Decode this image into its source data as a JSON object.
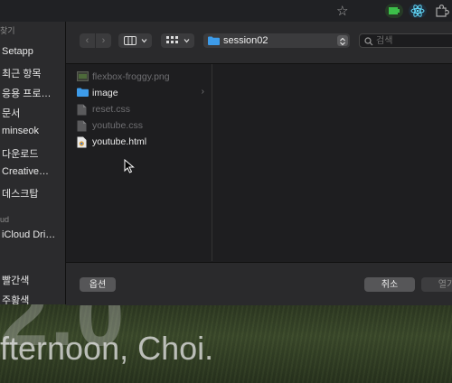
{
  "desktop": {
    "big_number": "2.0",
    "greeting": "fternoon, Choi."
  },
  "sidebar": {
    "section_favorites": "찾기",
    "section_icloud": "ud",
    "items": [
      {
        "label": "Setapp"
      },
      {
        "label": "최근 항목"
      },
      {
        "label": "응용 프로…"
      },
      {
        "label": "문서"
      },
      {
        "label": "minseok"
      },
      {
        "label": "다운로드"
      },
      {
        "label": "Creative…"
      },
      {
        "label": "데스크탑"
      },
      {
        "label": "iCloud Dri…"
      },
      {
        "label": "빨간색"
      },
      {
        "label": "주황색"
      }
    ]
  },
  "toolbar": {
    "path": "session02",
    "search_placeholder": "검색"
  },
  "files": [
    {
      "name": "flexbox-froggy.png",
      "type": "image",
      "enabled": false
    },
    {
      "name": "image",
      "type": "folder",
      "enabled": true
    },
    {
      "name": "reset.css",
      "type": "file",
      "enabled": false
    },
    {
      "name": "youtube.css",
      "type": "file",
      "enabled": false
    },
    {
      "name": "youtube.html",
      "type": "html",
      "enabled": true
    }
  ],
  "footer": {
    "options_label": "옵션",
    "cancel_label": "취소",
    "open_label": "열기"
  },
  "colors": {
    "folder": "#3d9be9",
    "accent": "#4a90e2"
  }
}
